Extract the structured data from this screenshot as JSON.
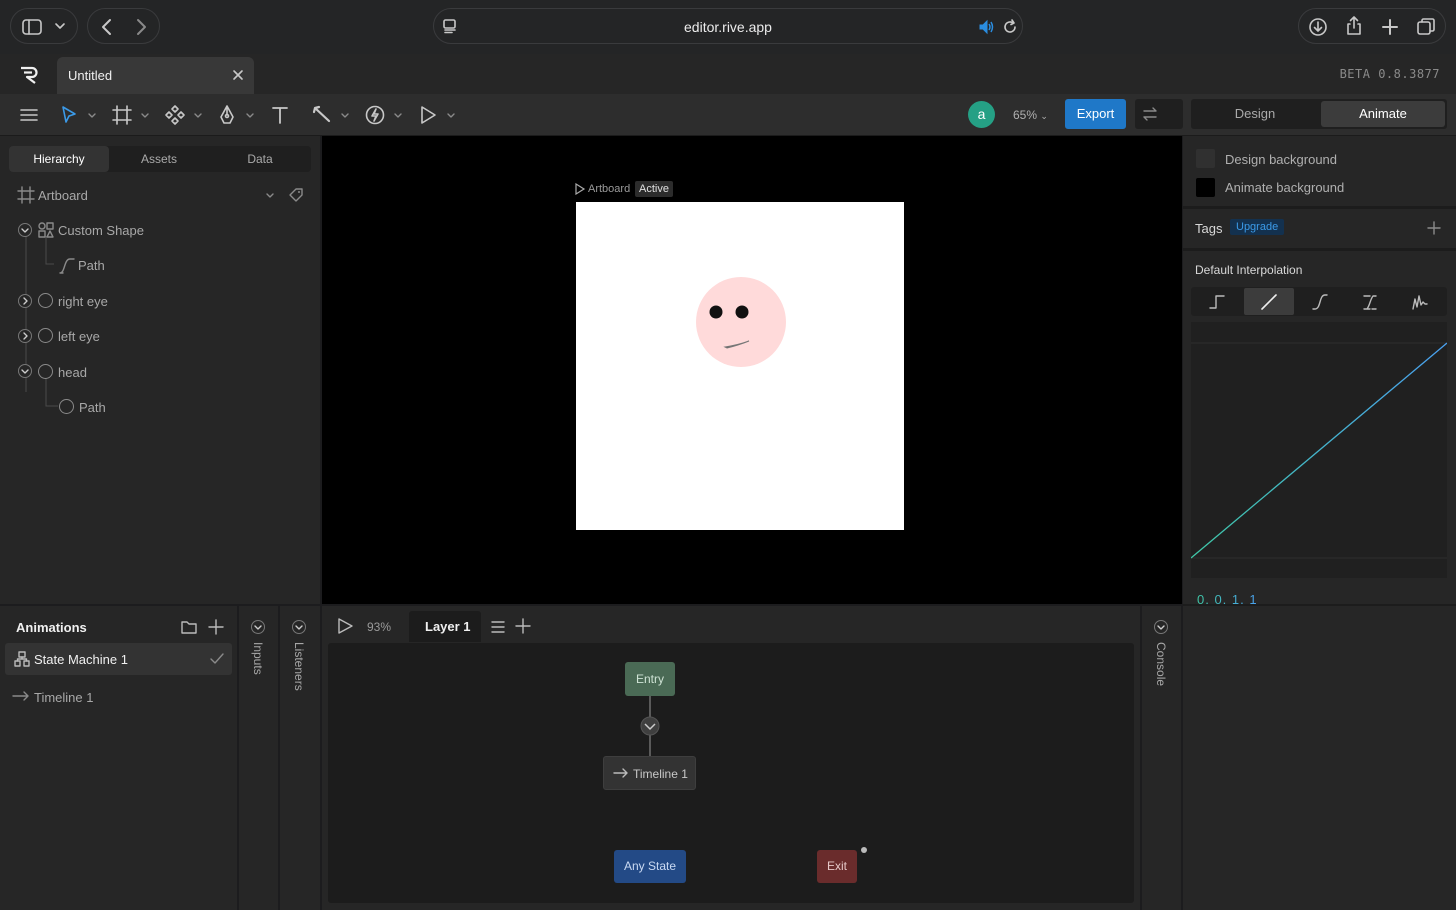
{
  "browser": {
    "url": "editor.rive.app"
  },
  "tab": {
    "title": "Untitled",
    "version": "BETA 0.8.3877"
  },
  "toolbar": {
    "avatar_letter": "a",
    "zoom": "65%",
    "export_label": "Export",
    "mode_tabs": [
      "Design",
      "Animate"
    ],
    "active_mode": "Animate"
  },
  "left": {
    "tabs": [
      "Hierarchy",
      "Assets",
      "Data"
    ],
    "artboard_label": "Artboard",
    "tree": [
      "Custom Shape",
      "Path",
      "right eye",
      "left eye",
      "head",
      "Path"
    ]
  },
  "canvas": {
    "artboard_name": "Artboard",
    "artboard_badge": "Active"
  },
  "right": {
    "design_background": "Design background",
    "animate_background": "Animate background",
    "tags_label": "Tags",
    "upgrade_badge": "Upgrade",
    "interp_title": "Default Interpolation",
    "curve_values": "0, 0, 1, 1"
  },
  "animations": {
    "title": "Animations",
    "items": [
      "State Machine 1",
      "Timeline 1"
    ]
  },
  "side_tabs": {
    "inputs": "Inputs",
    "listeners": "Listeners",
    "console": "Console"
  },
  "state_machine": {
    "zoom": "93%",
    "layer": "Layer 1",
    "nodes": {
      "entry": "Entry",
      "timeline": "Timeline 1",
      "any_state": "Any State",
      "exit": "Exit"
    }
  },
  "colors": {
    "accent": "#1f78c8",
    "entry": "#4a6a55",
    "any_state": "#234a86",
    "exit": "#6a2c2c",
    "avatar": "#25a085",
    "face": "#ffdada"
  }
}
